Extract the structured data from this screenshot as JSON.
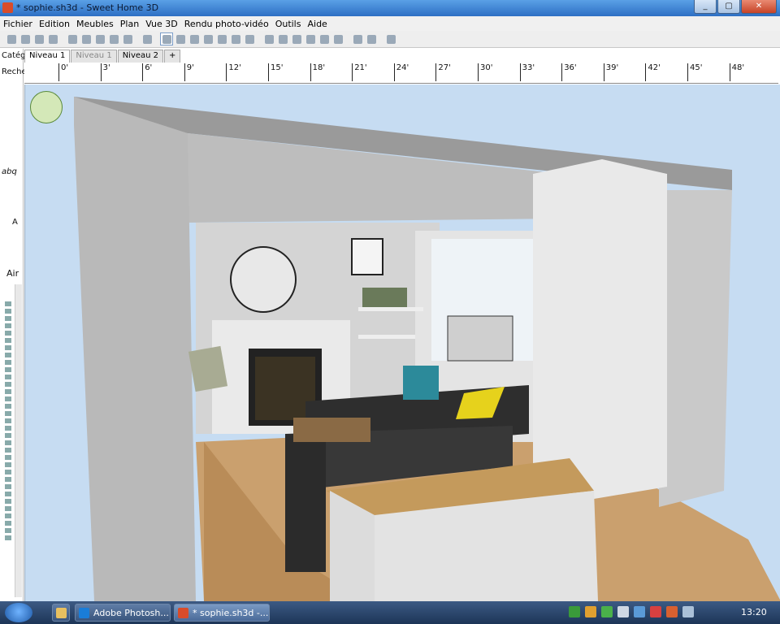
{
  "window": {
    "title": "* sophie.sh3d - Sweet Home 3D",
    "min": "_",
    "max": "▢",
    "close": "✕"
  },
  "menu": [
    "Fichier",
    "Edition",
    "Meubles",
    "Plan",
    "Vue 3D",
    "Rendu photo-vidéo",
    "Outils",
    "Aide"
  ],
  "toolbar_icons": [
    "new-icon",
    "open-icon",
    "save-icon",
    "cut-prefs-icon",
    "sep",
    "undo-icon",
    "redo-icon",
    "cut-icon",
    "copy-icon",
    "paste-icon",
    "sep",
    "add-furniture-icon",
    "sep",
    "select-icon",
    "pan-icon",
    "create-walls-icon",
    "create-rooms-icon",
    "create-polylines-icon",
    "create-dimensions-icon",
    "add-text-icon",
    "sep",
    "text-style-1-icon",
    "text-style-2-icon",
    "text-style-3-icon",
    "text-style-4-icon",
    "zoom-in-icon",
    "zoom-out-icon",
    "sep",
    "photo-icon",
    "video-icon",
    "sep",
    "help-icon"
  ],
  "left_pane": {
    "category_label": "Catég",
    "search_label": "Reche",
    "preview_text": "abq",
    "preview_letter": "A",
    "air_label": "Air"
  },
  "tabs": [
    {
      "label": "Niveau 1",
      "state": "active"
    },
    {
      "label": "Niveau 1",
      "state": "disabled"
    },
    {
      "label": "Niveau 2",
      "state": "normal"
    },
    {
      "label": "+",
      "state": "add"
    }
  ],
  "ruler": [
    "0'",
    "3'",
    "6'",
    "9'",
    "12'",
    "15'",
    "18'",
    "21'",
    "24'",
    "27'",
    "30'",
    "33'",
    "36'",
    "39'",
    "42'",
    "45'",
    "48'"
  ],
  "taskbar": {
    "buttons": [
      {
        "label": "Adobe Photosh...",
        "color": "#1a7dd8"
      },
      {
        "label": "* sophie.sh3d -...",
        "color": "#d84c2a"
      }
    ],
    "clock": "13:20"
  },
  "colors": {
    "sky": "#c6dcf2",
    "floor": "#caa06e",
    "wall": "#d8d8d8",
    "brick": "#e9e9e9",
    "sofa": "#2e2e2e"
  }
}
